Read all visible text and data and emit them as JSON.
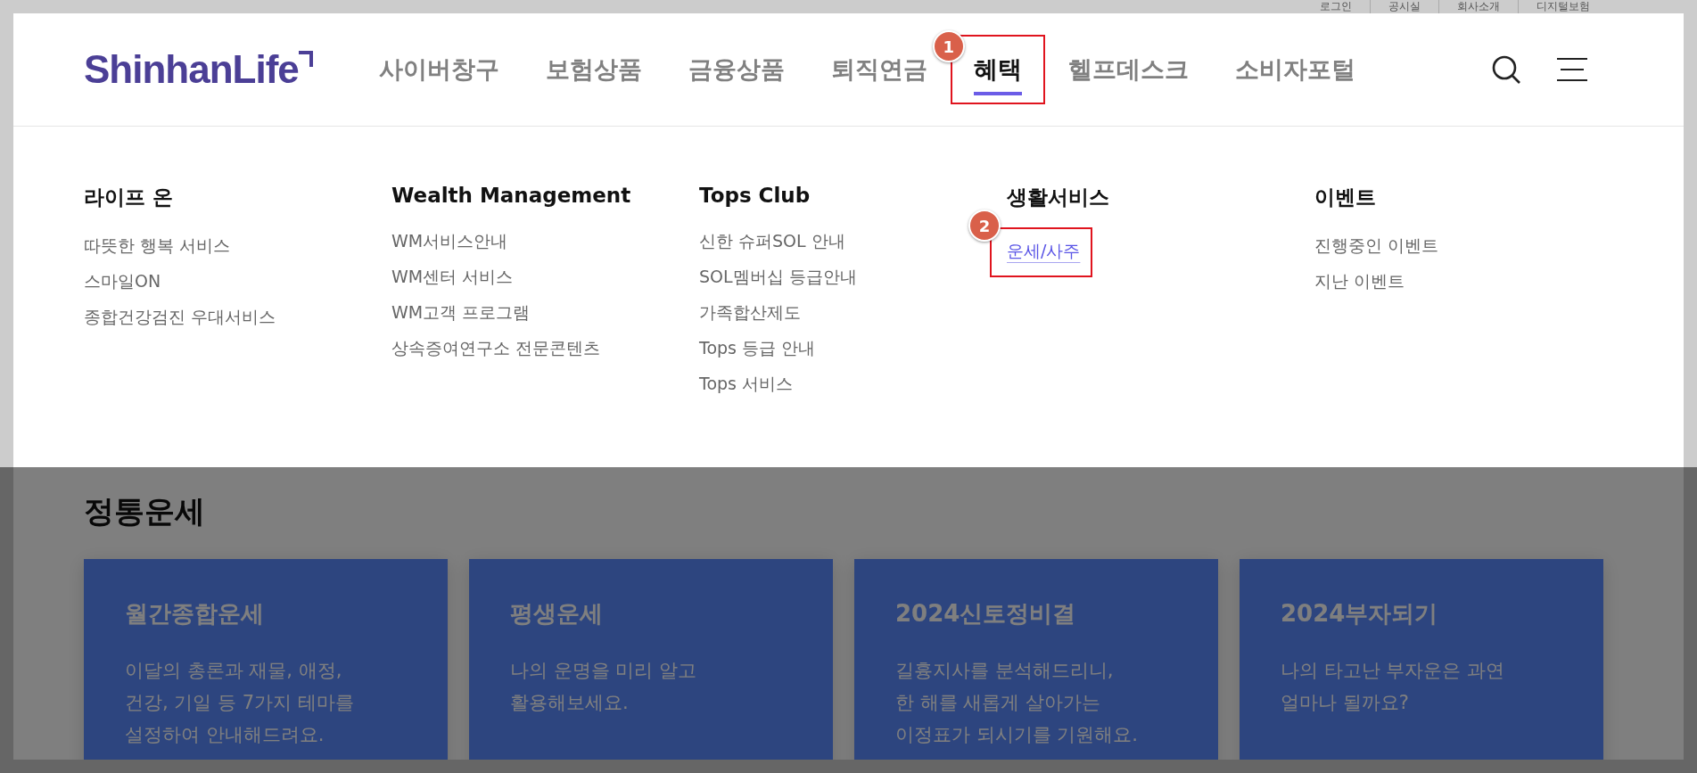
{
  "utility_links": [
    "로그인",
    "공시실",
    "회사소개",
    "디지털보험"
  ],
  "header": {
    "logo": "ShinhanLife",
    "nav": [
      {
        "label": "사이버창구",
        "selected": false
      },
      {
        "label": "보험상품",
        "selected": false
      },
      {
        "label": "금융상품",
        "selected": false
      },
      {
        "label": "퇴직연금",
        "selected": false
      },
      {
        "label": "혜택",
        "selected": true,
        "annotation": "1"
      },
      {
        "label": "헬프데스크",
        "selected": false
      },
      {
        "label": "소비자포털",
        "selected": false
      }
    ]
  },
  "mega_menu": [
    {
      "heading": "라이프 온",
      "items": [
        {
          "label": "따뜻한 행복 서비스",
          "selected": false
        },
        {
          "label": "스마일ON",
          "selected": false
        },
        {
          "label": "종합건강검진 우대서비스",
          "selected": false
        }
      ]
    },
    {
      "heading": "Wealth Management",
      "items": [
        {
          "label": "WM서비스안내",
          "selected": false
        },
        {
          "label": "WM센터 서비스",
          "selected": false
        },
        {
          "label": "WM고객 프로그램",
          "selected": false
        },
        {
          "label": "상속증여연구소 전문콘텐츠",
          "selected": false
        }
      ]
    },
    {
      "heading": "Tops Club",
      "items": [
        {
          "label": "신한 슈퍼SOL 안내",
          "selected": false
        },
        {
          "label": "SOL멤버십 등급안내",
          "selected": false
        },
        {
          "label": "가족합산제도",
          "selected": false
        },
        {
          "label": "Tops 등급 안내",
          "selected": false
        },
        {
          "label": "Tops 서비스",
          "selected": false
        }
      ]
    },
    {
      "heading": "생활서비스",
      "items": [
        {
          "label": "운세/사주",
          "selected": true,
          "annotation": "2"
        }
      ]
    },
    {
      "heading": "이벤트",
      "items": [
        {
          "label": "진행중인 이벤트",
          "selected": false
        },
        {
          "label": "지난 이벤트",
          "selected": false
        }
      ]
    }
  ],
  "section": {
    "title": "정통운세",
    "cards": [
      {
        "title": "월간종합운세",
        "description": "이달의 총론과 재물, 애정,\n건강, 기일 등 7가지 테마를\n설정하여 안내해드려요."
      },
      {
        "title": "평생운세",
        "description": "나의 운명을 미리 알고\n활용해보세요."
      },
      {
        "title": "2024신토정비결",
        "description": "길흉지사를 분석해드리니,\n한 해를 새롭게 살아가는\n이정표가 되시기를 기원해요."
      },
      {
        "title": "2024부자되기",
        "description": "나의 타고난 부자운은 과연\n얼마나 될까요?"
      }
    ]
  }
}
